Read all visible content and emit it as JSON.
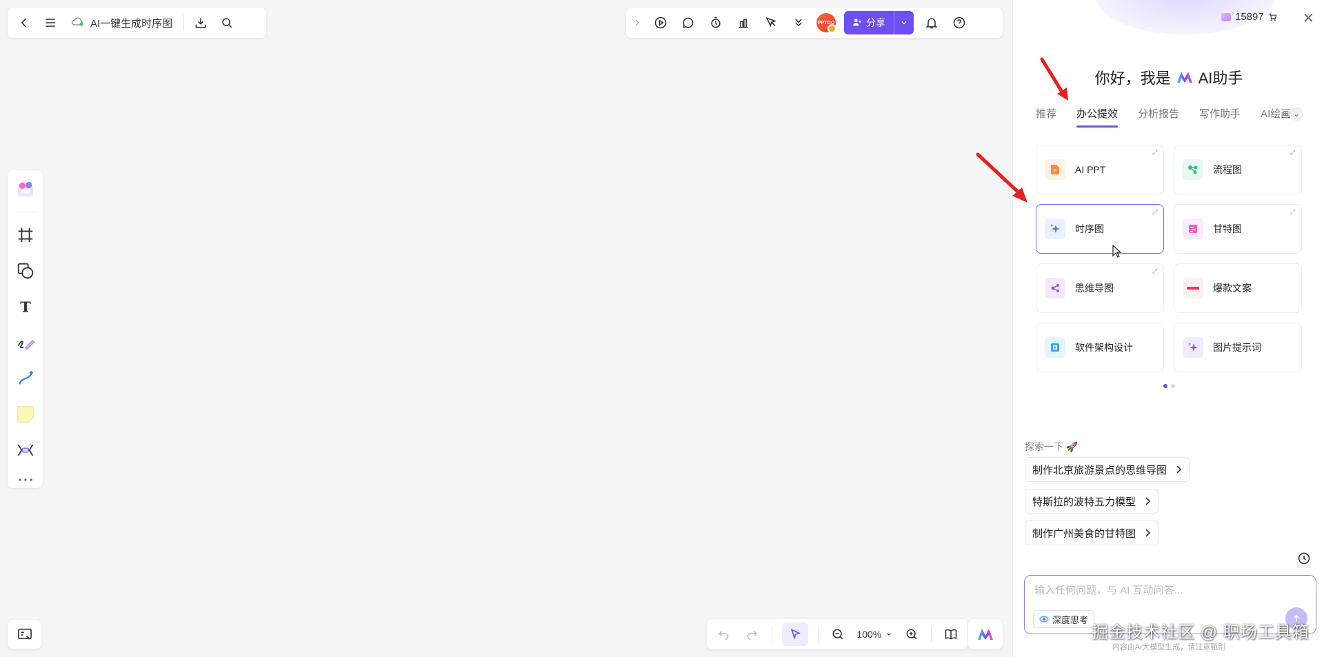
{
  "header": {
    "doc_title": "AI一键生成时序图",
    "share_label": "分享",
    "avatar_text": "PPTOO"
  },
  "zoom": {
    "level": "100%"
  },
  "panel": {
    "credits": "15897",
    "greeting_prefix": "你好，我是",
    "greeting_suffix": "AI助手",
    "tabs": [
      {
        "label": "推荐"
      },
      {
        "label": "办公提效",
        "active": true
      },
      {
        "label": "分析报告"
      },
      {
        "label": "写作助手"
      },
      {
        "label": "AI绘画"
      }
    ],
    "tiles": [
      {
        "label": "AI PPT",
        "icon": "ppt-icon",
        "color": "#ff8a3d"
      },
      {
        "label": "流程图",
        "icon": "flowchart-icon",
        "color": "#2bc47a"
      },
      {
        "label": "时序图",
        "icon": "sparkle-icon",
        "color": "#4a7cf7",
        "active": true
      },
      {
        "label": "甘特图",
        "icon": "gantt-icon",
        "color": "#f25ac4"
      },
      {
        "label": "思维导图",
        "icon": "mindmap-icon",
        "color": "#8a5cf5"
      },
      {
        "label": "爆款文案",
        "icon": "xiaohongshu-icon",
        "color": "#ff3355"
      },
      {
        "label": "软件架构设计",
        "icon": "architecture-icon",
        "color": "#3aa6f2"
      },
      {
        "label": "图片提示词",
        "icon": "sparkle-icon",
        "color": "#8a5cf5"
      }
    ],
    "explore_title": "探索一下",
    "suggestions": [
      {
        "label": "制作北京旅游景点的思维导图"
      },
      {
        "label": "特斯拉的波特五力模型"
      },
      {
        "label": "制作广州美食的甘特图"
      }
    ],
    "input_placeholder": "输入任何问题，与 AI 互动问答...",
    "deep_think_label": "深度思考",
    "disclaimer": "内容由AI大模型生成，请注意甄别"
  },
  "watermark": "掘金技术社区 @ 职场工具箱",
  "colors": {
    "accent": "#6f4ef2",
    "arrow": "#e62020"
  }
}
